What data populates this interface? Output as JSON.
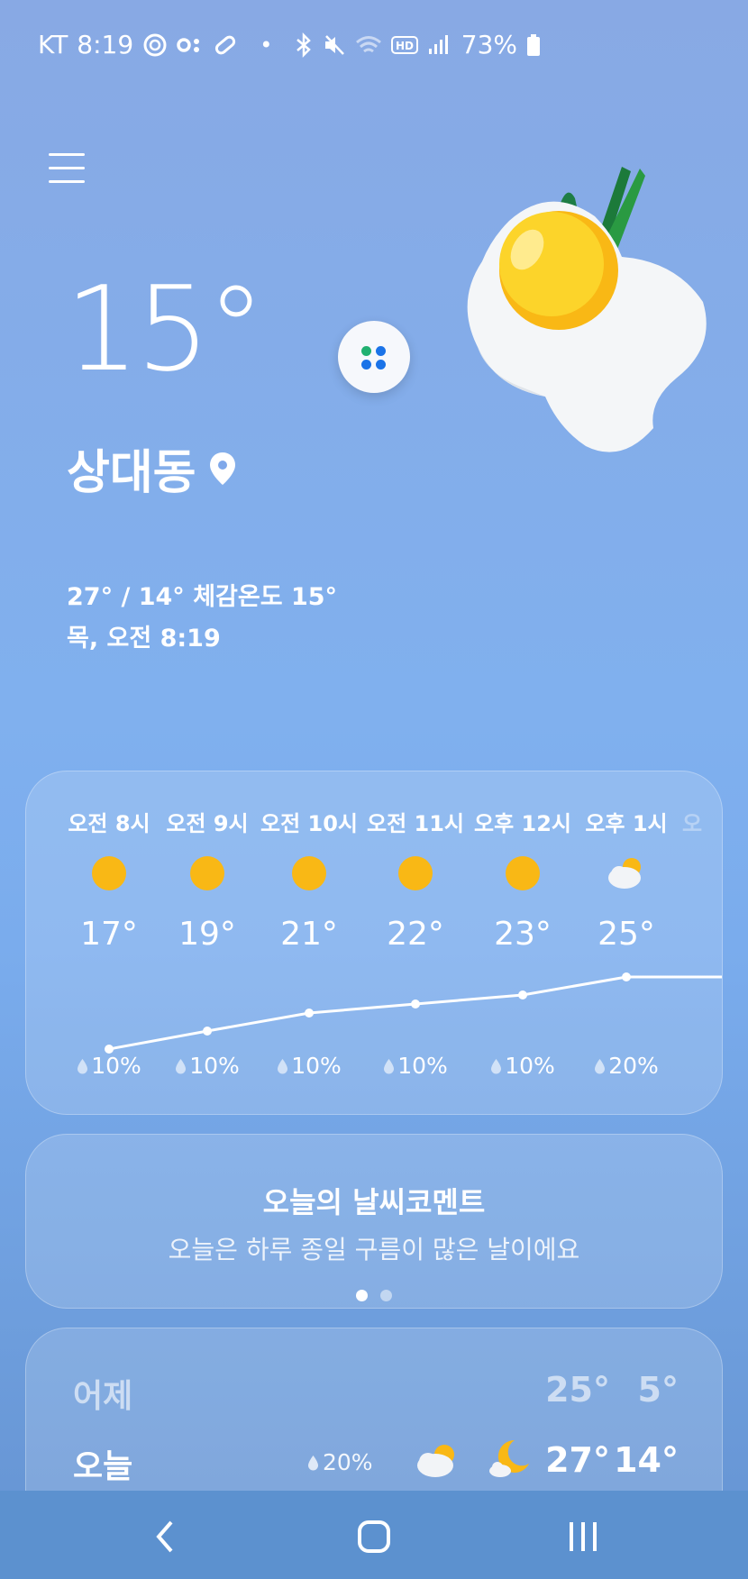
{
  "status": {
    "carrier": "KT",
    "time": "8:19",
    "battery": "73%",
    "left_icons": [
      "pin-icon",
      "loop-icon",
      "pill-icon",
      "dot-icon"
    ],
    "right_icons": [
      "bluetooth-icon",
      "mute-icon",
      "wifi-icon",
      "hd-icon",
      "signal-icon",
      "battery-icon"
    ]
  },
  "current": {
    "temp": "15°",
    "location": "상대동",
    "feels_line": "27° / 14° 체감온도 15°",
    "datetime": "목, 오전 8:19"
  },
  "hourly": [
    {
      "time": "오전 8시",
      "icon": "sun-icon",
      "temp": "17°",
      "precip": "10%",
      "t": 17
    },
    {
      "time": "오전 9시",
      "icon": "sun-icon",
      "temp": "19°",
      "precip": "10%",
      "t": 19
    },
    {
      "time": "오전 10시",
      "icon": "sun-icon",
      "temp": "21°",
      "precip": "10%",
      "t": 21
    },
    {
      "time": "오전 11시",
      "icon": "sun-icon",
      "temp": "22°",
      "precip": "10%",
      "t": 22
    },
    {
      "time": "오후 12시",
      "icon": "sun-icon",
      "temp": "23°",
      "precip": "10%",
      "t": 23
    },
    {
      "time": "오후 1시",
      "icon": "partly-cloudy-icon",
      "temp": "25°",
      "precip": "20%",
      "t": 25
    }
  ],
  "comment": {
    "title": "오늘의 날씨코멘트",
    "text": "오늘은 하루 종일 구름이 많은 날이에요",
    "pages": 2,
    "active_page": 0
  },
  "daily": [
    {
      "day": "어제",
      "hi": "25°",
      "lo": "5°"
    },
    {
      "day": "오늘",
      "precip": "20%",
      "day_icon": "partly-cloudy-icon",
      "night_icon": "moon-cloud-icon",
      "hi": "27°",
      "lo": "14°"
    }
  ],
  "colors": {
    "sun": "#f9b815",
    "accent_blue": "#1a73e8",
    "accent_green": "#20b070"
  }
}
